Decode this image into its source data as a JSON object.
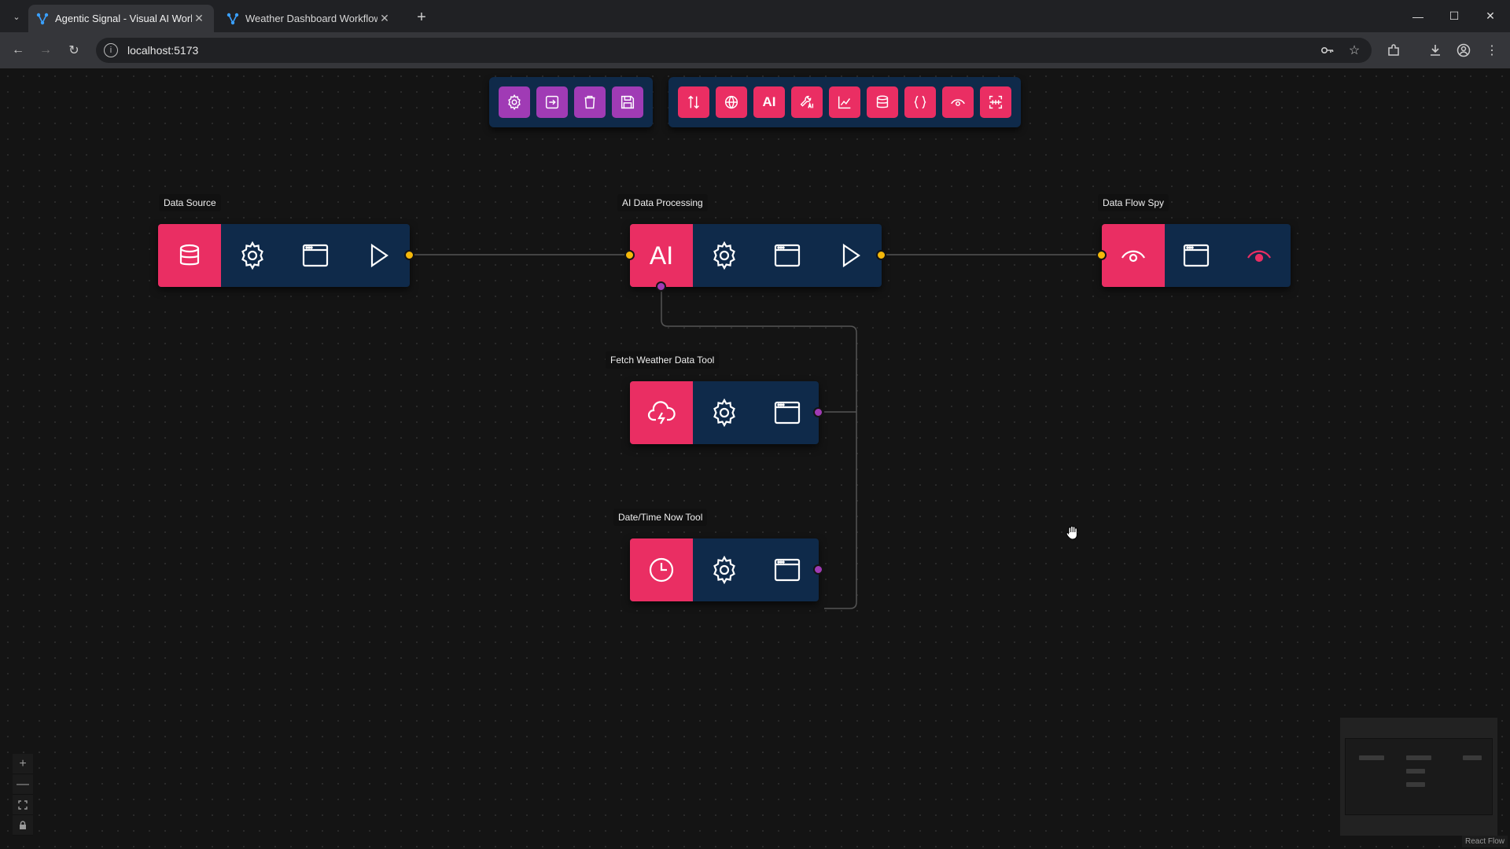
{
  "browser": {
    "tabs": [
      {
        "title": "Agentic Signal - Visual AI Work",
        "active": true
      },
      {
        "title": "Weather Dashboard Workflow |",
        "active": false
      }
    ],
    "url": "localhost:5173"
  },
  "palette": {
    "left_group": [
      "settings-icon",
      "import-icon",
      "clear-icon",
      "save-icon"
    ],
    "right_group": [
      "data-io-icon",
      "web-icon",
      "ai-icon",
      "ai-tool-icon",
      "chart-icon",
      "database-icon",
      "json-icon",
      "spy-icon",
      "scraper-icon"
    ],
    "ai_label": "AI"
  },
  "nodes": {
    "data_source": {
      "label": "Data Source"
    },
    "ai_processing": {
      "label": "AI Data Processing",
      "icon_text": "AI"
    },
    "data_flow_spy": {
      "label": "Data Flow Spy"
    },
    "fetch_weather": {
      "label": "Fetch Weather Data Tool"
    },
    "datetime_tool": {
      "label": "Date/Time Now Tool"
    }
  },
  "colors": {
    "node_accent": "#ea2e63",
    "node_body": "#0f2a4a",
    "palette_purple": "#a03bb5",
    "handle_data": "#f5b80a",
    "handle_tool": "#a03bb5"
  },
  "controls": {
    "zoom_in": "+",
    "zoom_out": "—"
  },
  "attribution": "React Flow"
}
